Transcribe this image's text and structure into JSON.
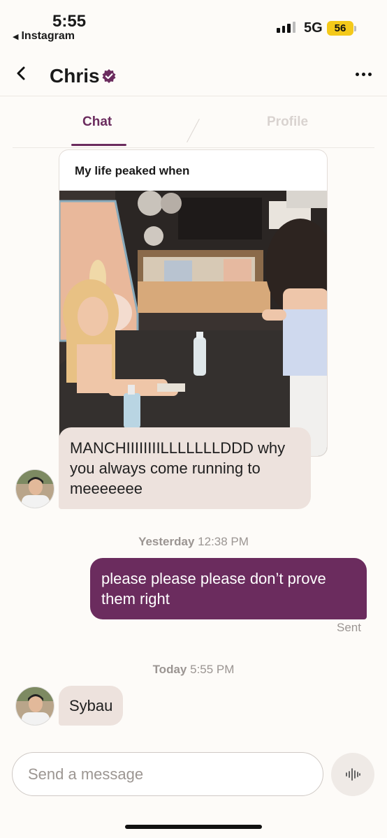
{
  "status_bar": {
    "time": "5:55",
    "back_app": "Instagram",
    "network": "5G",
    "battery": "56"
  },
  "header": {
    "name": "Chris"
  },
  "tabs": [
    {
      "label": "Chat",
      "active": true
    },
    {
      "label": "Profile",
      "active": false
    }
  ],
  "prompt_card": {
    "title": "My life peaked when"
  },
  "messages": [
    {
      "from": "them",
      "text": "MANCHIIIIIIIILLLLLLLDDD why you always come running to meeeeeee"
    },
    {
      "timestamp_day": "Yesterday",
      "timestamp_time": "12:38 PM"
    },
    {
      "from": "me",
      "text": "please please please don’t prove them right",
      "status": "Sent"
    },
    {
      "timestamp_day": "Today",
      "timestamp_time": "5:55 PM"
    },
    {
      "from": "them",
      "text": "Sybau"
    }
  ],
  "composer": {
    "placeholder": "Send a message"
  },
  "colors": {
    "accent": "#6b2c5e",
    "incoming_bubble": "#ede2dd",
    "battery": "#f4c91a"
  },
  "icons": [
    "chevron-left-icon",
    "verified-badge-icon",
    "more-horizontal-icon",
    "voice-waveform-icon",
    "signal-icon"
  ]
}
